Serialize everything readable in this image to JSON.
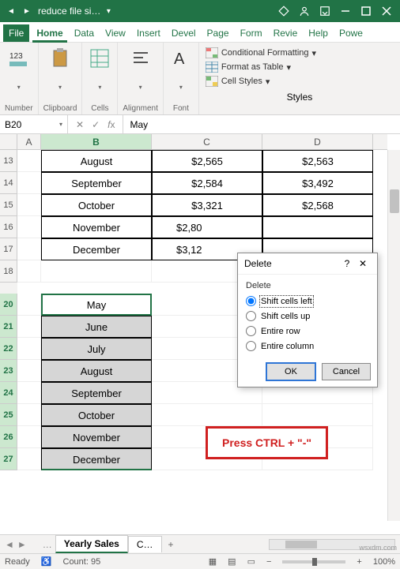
{
  "titlebar": {
    "filename": "reduce file si…"
  },
  "menutabs": [
    "File",
    "Home",
    "Data",
    "View",
    "Insert",
    "Devel",
    "Page",
    "Form",
    "Revie",
    "Help",
    "Powe"
  ],
  "ribbon": {
    "groups": [
      "Number",
      "Clipboard",
      "Cells",
      "Alignment",
      "Font",
      "Styles"
    ],
    "styles": {
      "cond": "Conditional Formatting",
      "table": "Format as Table",
      "cell": "Cell Styles"
    }
  },
  "namebox": "B20",
  "formula": "May",
  "colheads": [
    "A",
    "B",
    "C",
    "D"
  ],
  "rows_top": [
    {
      "n": "13",
      "b": "August",
      "c": "$2,565",
      "d": "$2,563"
    },
    {
      "n": "14",
      "b": "September",
      "c": "$2,584",
      "d": "$3,492"
    },
    {
      "n": "15",
      "b": "October",
      "c": "$3,321",
      "d": "$2,568"
    },
    {
      "n": "16",
      "b": "November",
      "c": "$2,80",
      "d": ""
    },
    {
      "n": "17",
      "b": "December",
      "c": "$3,12",
      "d": ""
    },
    {
      "n": "18",
      "b": "",
      "c": "",
      "d": ""
    }
  ],
  "rows_sel": [
    {
      "n": "20",
      "b": "May"
    },
    {
      "n": "21",
      "b": "June"
    },
    {
      "n": "22",
      "b": "July"
    },
    {
      "n": "23",
      "b": "August"
    },
    {
      "n": "24",
      "b": "September"
    },
    {
      "n": "25",
      "b": "October"
    },
    {
      "n": "26",
      "b": "November"
    },
    {
      "n": "27",
      "b": "December"
    }
  ],
  "dialog": {
    "title": "Delete",
    "group": "Delete",
    "opts": [
      "Shift cells left",
      "Shift cells up",
      "Entire row",
      "Entire column"
    ],
    "ok": "OK",
    "cancel": "Cancel",
    "help": "?"
  },
  "annotation": "Press CTRL + \"-\"",
  "sheets": {
    "active": "Yearly Sales",
    "next": "C…",
    "add": "+"
  },
  "status": {
    "mode": "Ready",
    "count_lbl": "Count:",
    "count": "95",
    "zoom": "100%"
  },
  "watermark": "wsxdm.com"
}
